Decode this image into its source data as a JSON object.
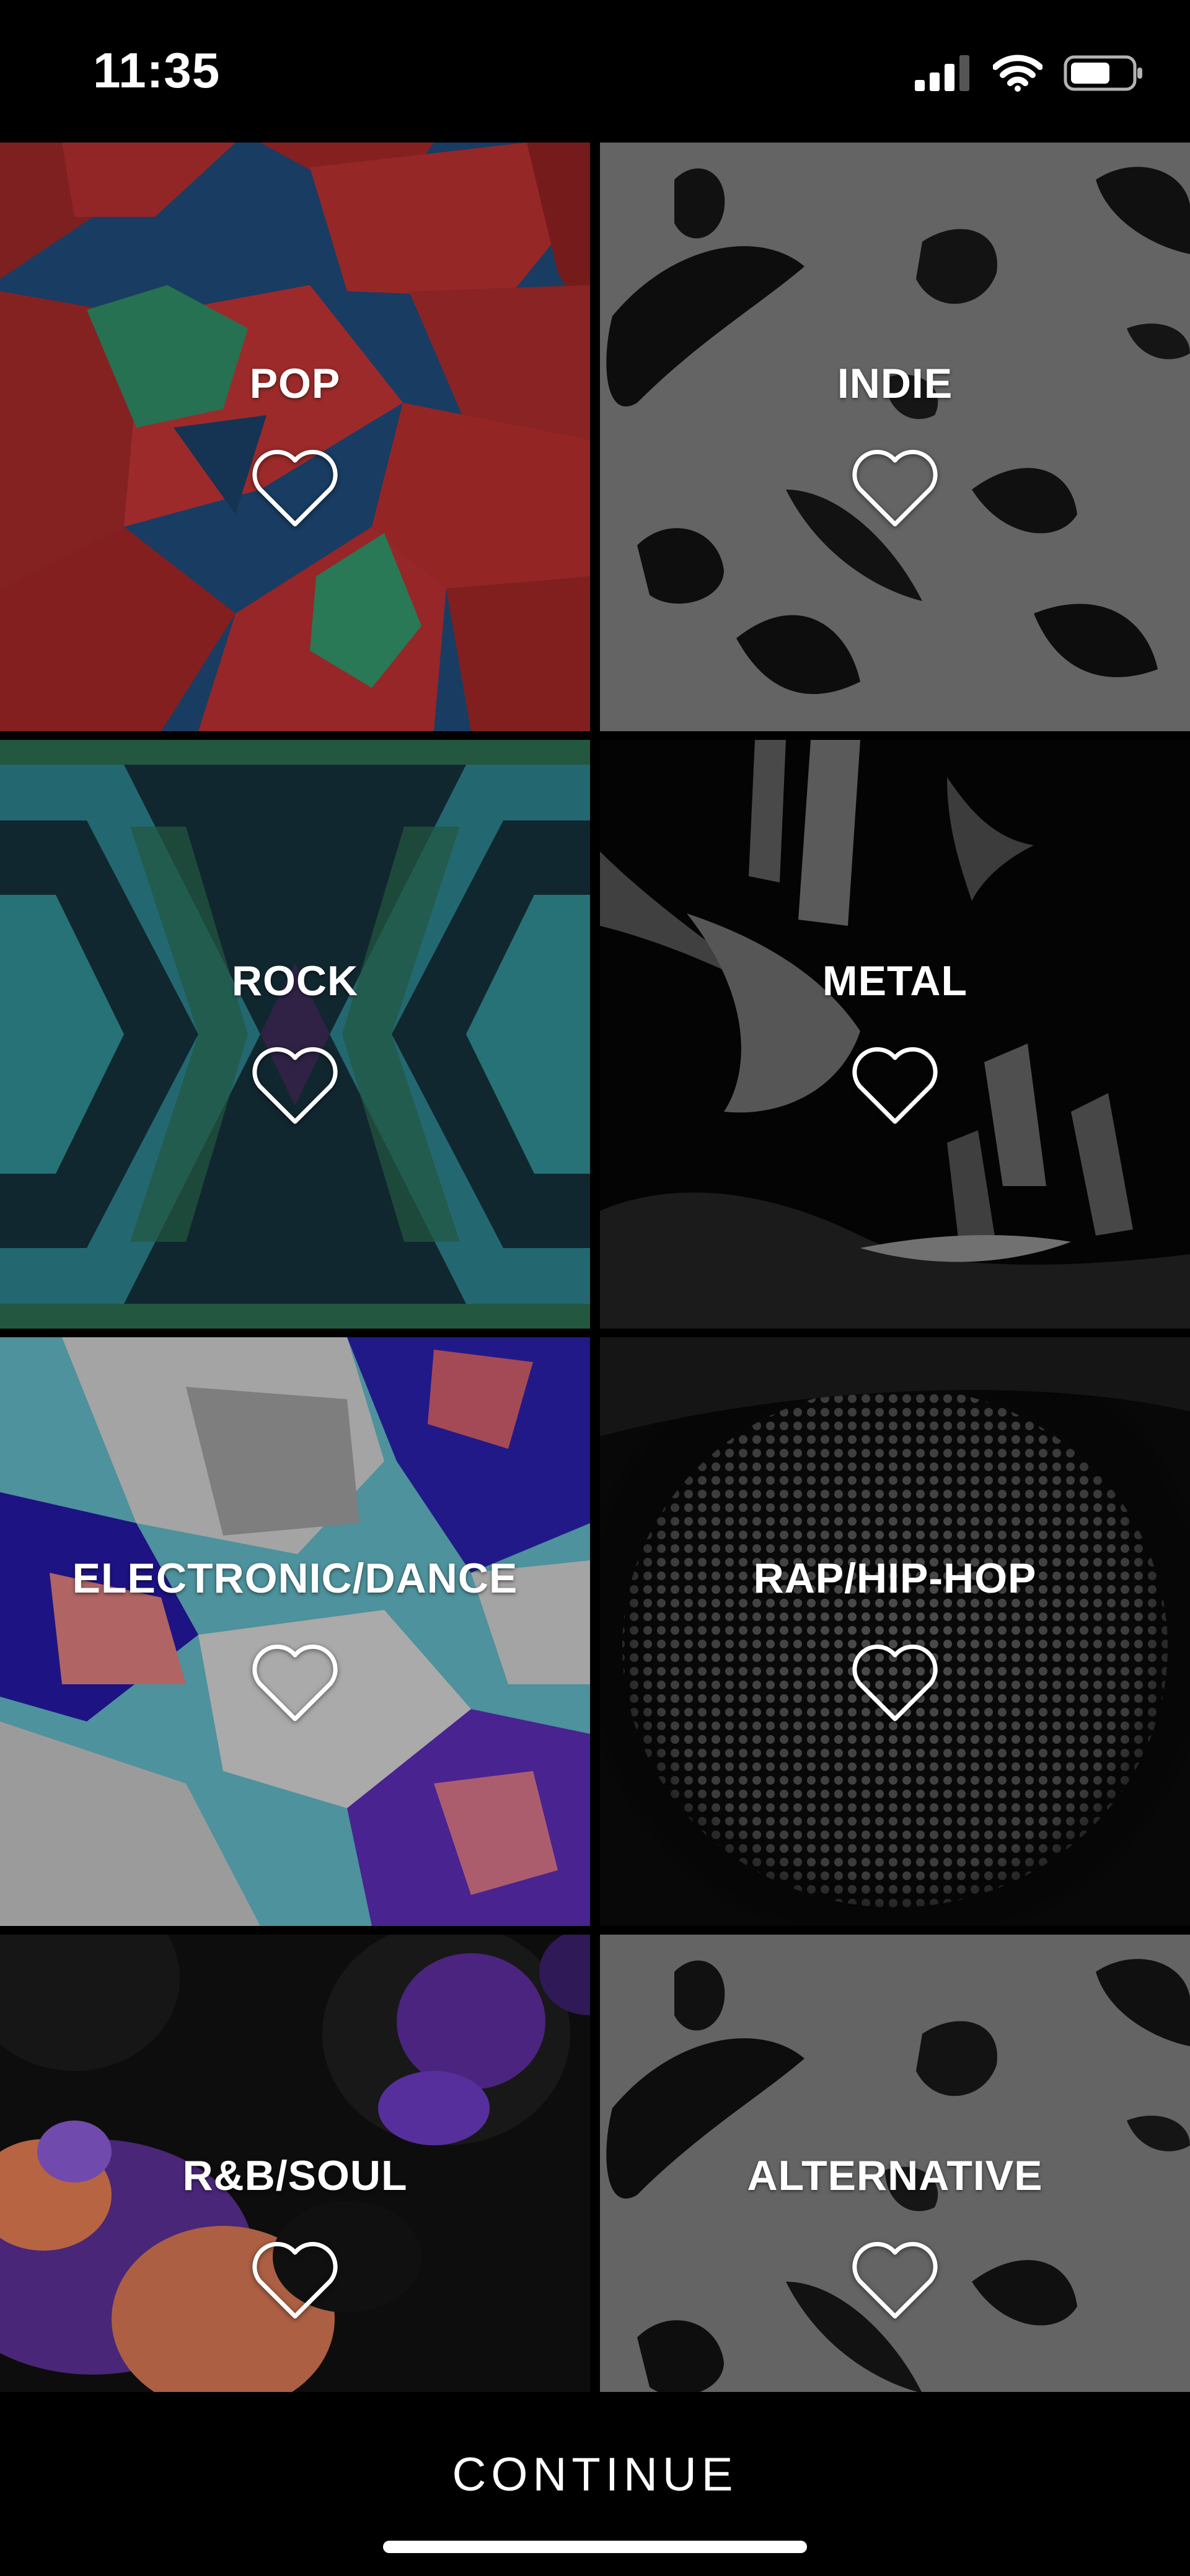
{
  "status_bar": {
    "time": "11:35",
    "icons": [
      "cellular-signal-icon",
      "wifi-icon",
      "battery-icon"
    ]
  },
  "genres": [
    {
      "label": "POP",
      "favorited": false,
      "theme": "red-blue-green polygons",
      "colors": [
        "#1f4a78",
        "#a32a2a",
        "#2f8a63"
      ]
    },
    {
      "label": "INDIE",
      "favorited": false,
      "theme": "grey marble splatter",
      "colors": [
        "#7d7d7d",
        "#141414"
      ]
    },
    {
      "label": "ROCK",
      "favorited": false,
      "theme": "teal chevrons",
      "colors": [
        "#1b3b45",
        "#2f8c91",
        "#2b6b4f"
      ]
    },
    {
      "label": "METAL",
      "favorited": false,
      "theme": "dark splinters",
      "colors": [
        "#050505",
        "#6e6e6e"
      ]
    },
    {
      "label": "ELECTRONIC/DANCE",
      "favorited": false,
      "theme": "purple and white shards",
      "colors": [
        "#63b8c4",
        "#2a1fa6",
        "#c9c9c9",
        "#c85a6a"
      ]
    },
    {
      "label": "RAP/HIP-HOP",
      "favorited": false,
      "theme": "halftone dots",
      "colors": [
        "#0a0a0a",
        "#5a5a5a"
      ]
    },
    {
      "label": "R&B/SOUL",
      "favorited": false,
      "theme": "purple blobs",
      "colors": [
        "#111111",
        "#5b2d9a",
        "#e07a52"
      ]
    },
    {
      "label": "ALTERNATIVE",
      "favorited": false,
      "theme": "grey marble splatter",
      "colors": [
        "#7d7d7d",
        "#141414"
      ]
    }
  ],
  "footer": {
    "continue_label": "CONTINUE"
  }
}
